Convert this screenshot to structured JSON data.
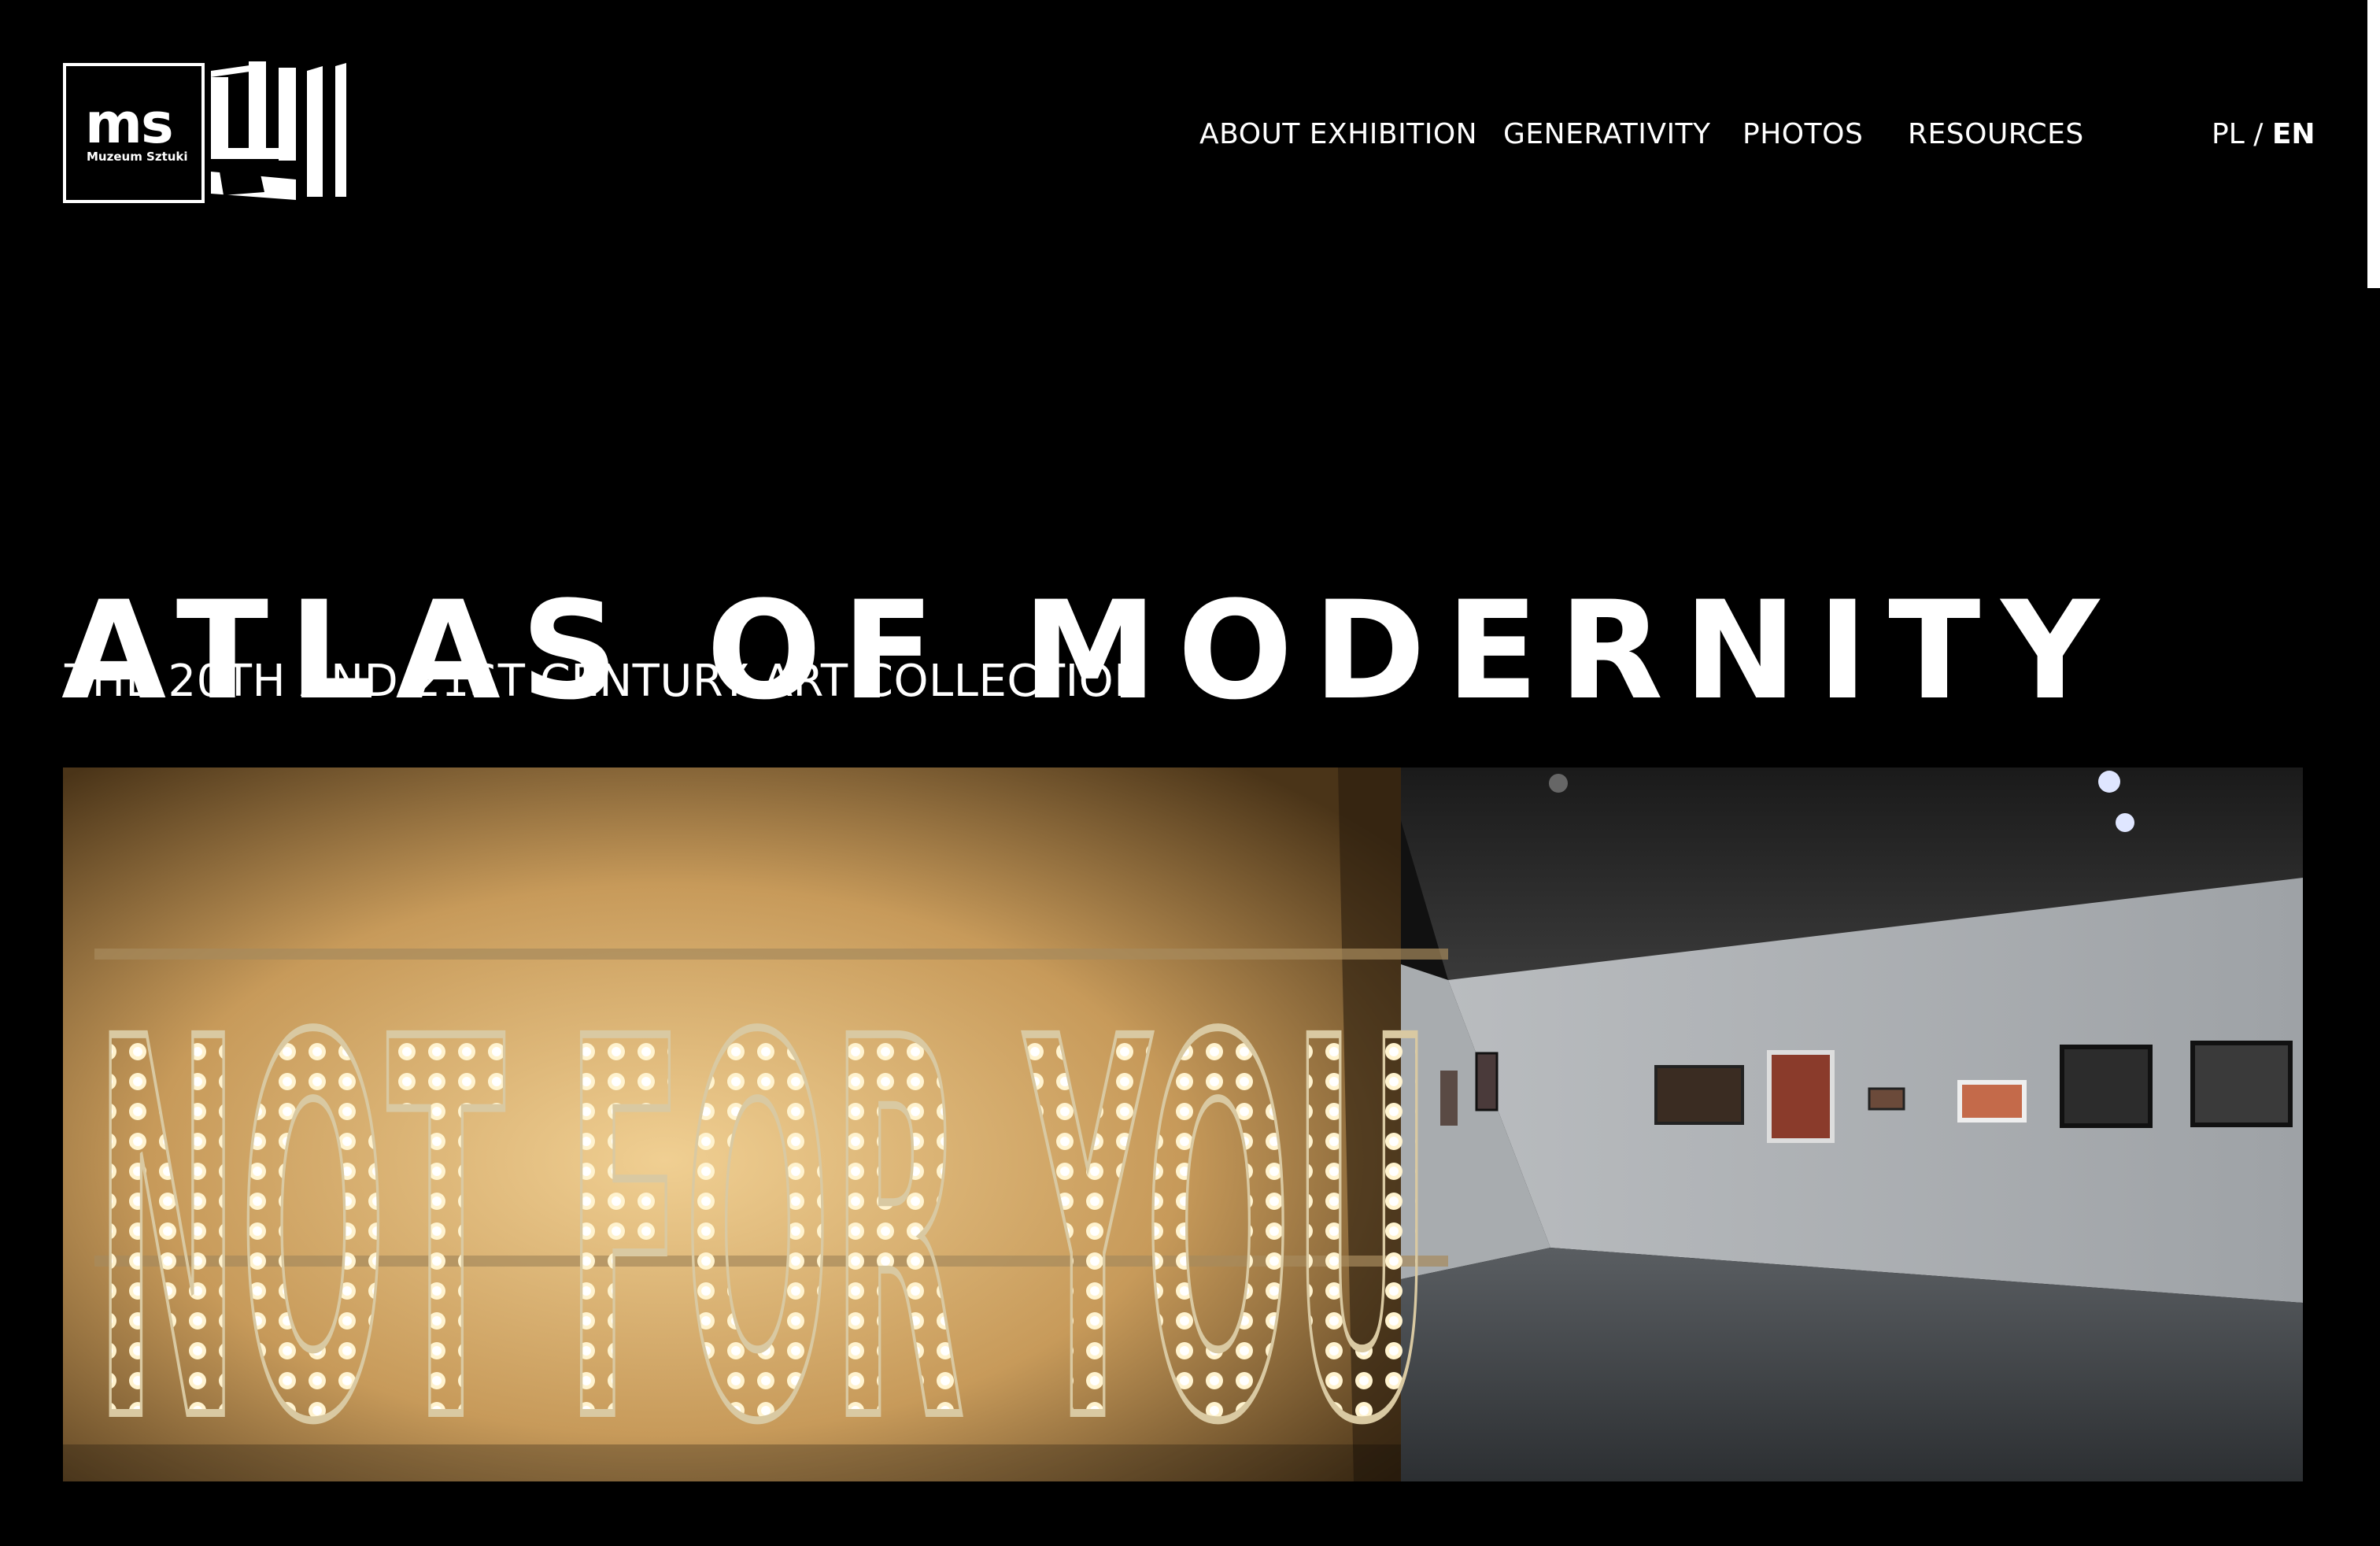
{
  "logo": {
    "text": "ms",
    "subtext": "Muzeum Sztuki"
  },
  "nav": {
    "items": [
      {
        "label": "ABOUT EXHIBITION"
      },
      {
        "label": "GENERATIVITY"
      },
      {
        "label": "PHOTOS"
      },
      {
        "label": "RESOURCES"
      }
    ]
  },
  "lang": {
    "pl": "PL",
    "separator": "/",
    "en": "EN",
    "active": "EN"
  },
  "hero": {
    "title": "ATLAS OF MODERNITY",
    "subtitle": "THE 20TH AND 21ST CENTURY ART COLLECTION",
    "image_sign_text": "NOT FOR YOU"
  },
  "colors": {
    "background": "#000000",
    "text": "#ffffff"
  }
}
